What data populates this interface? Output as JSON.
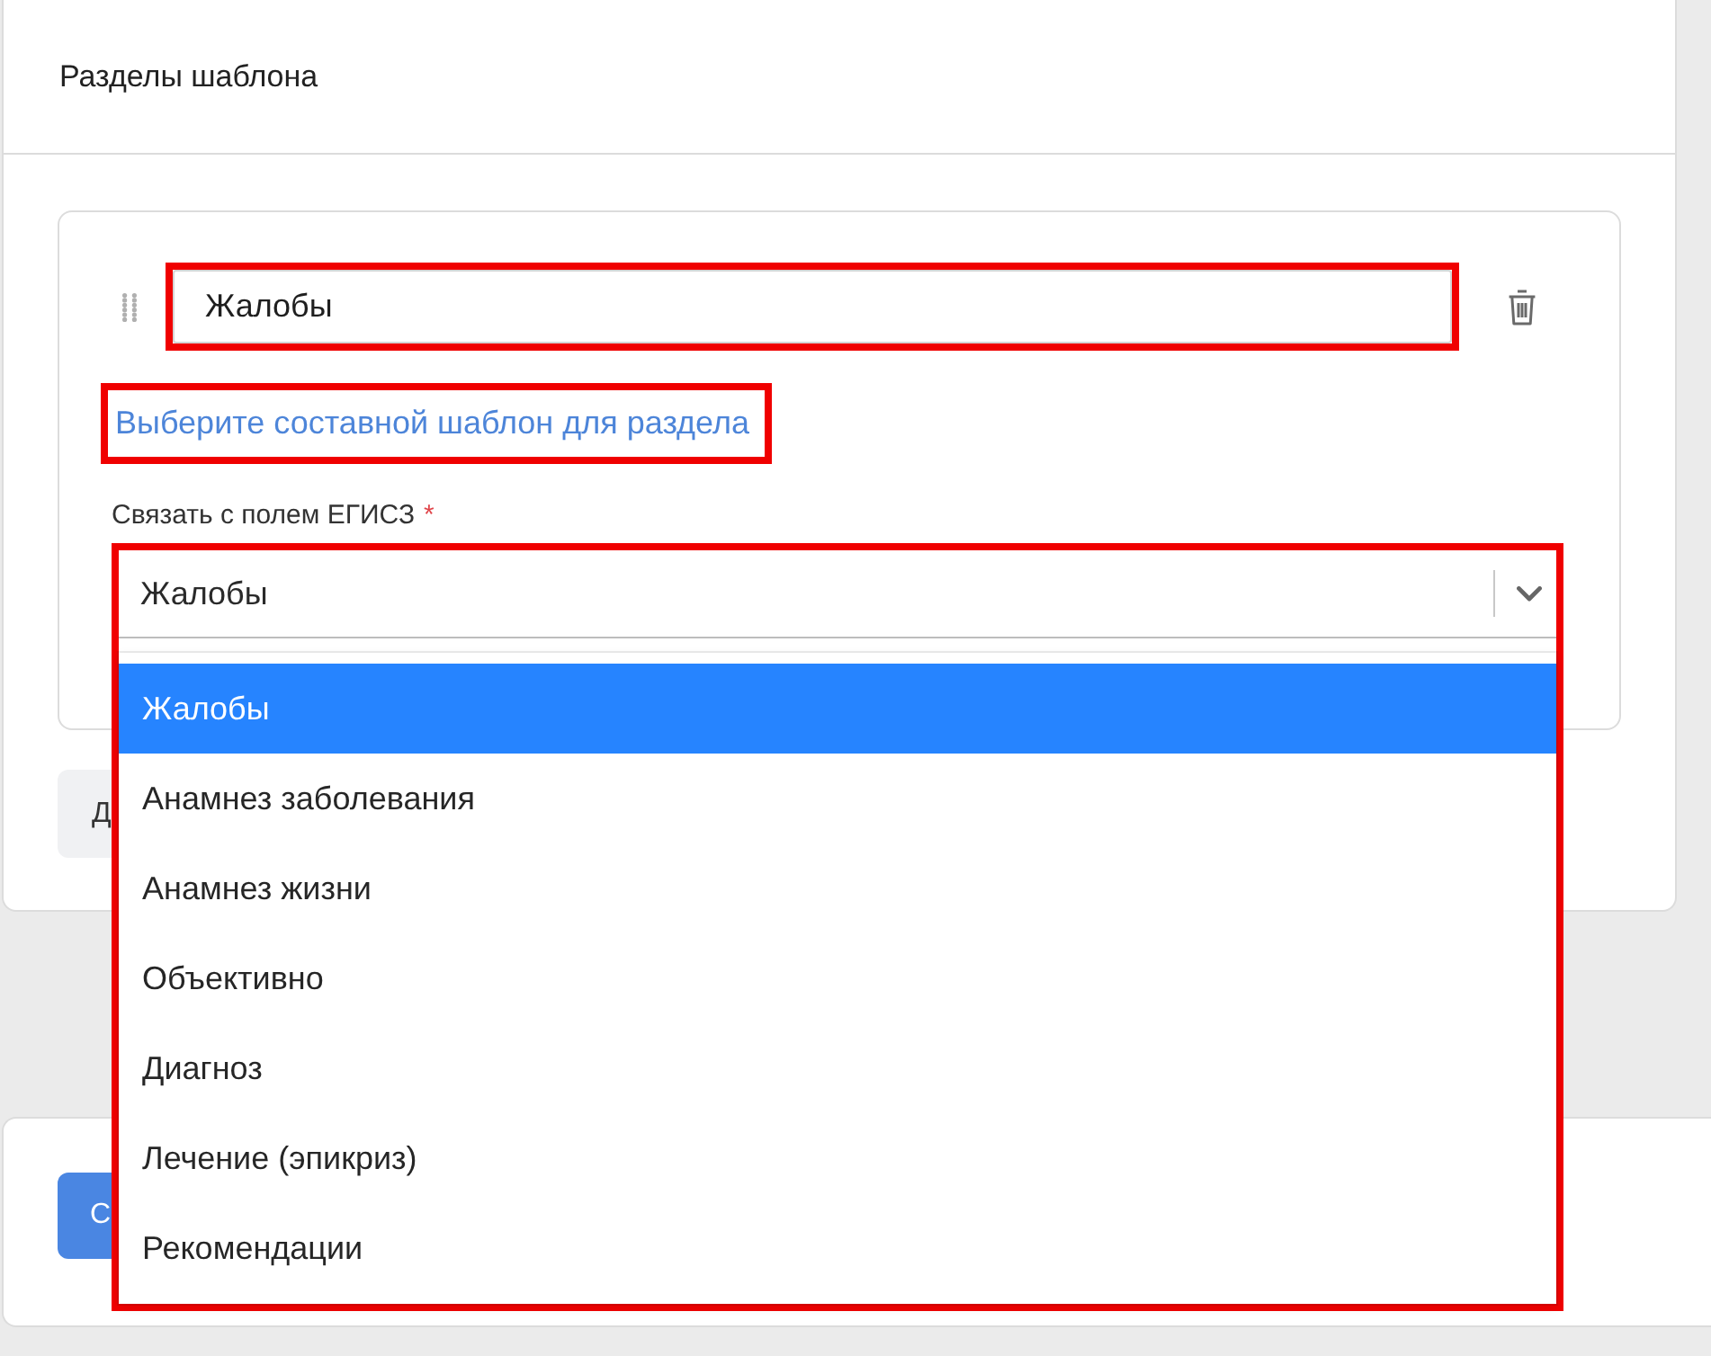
{
  "panel": {
    "title": "Разделы шаблона"
  },
  "sections": [
    {
      "name_field": {
        "value": "Жалобы",
        "highlighted": true
      },
      "template_link": {
        "label": "Выберите составной шаблон для раздела",
        "highlighted": true
      },
      "ehr_field": {
        "label": "Связать с полем ЕГИСЗ",
        "required_mark": "*",
        "value": "Жалобы",
        "expanded": true,
        "highlighted": true,
        "options": [
          {
            "label": "Жалобы",
            "selected": true
          },
          {
            "label": "Анамнез заболевания",
            "selected": false
          },
          {
            "label": "Анамнез жизни",
            "selected": false
          },
          {
            "label": "Объективно",
            "selected": false
          },
          {
            "label": "Диагноз",
            "selected": false
          },
          {
            "label": "Лечение (эпикриз)",
            "selected": false
          },
          {
            "label": "Рекомендации",
            "selected": false
          }
        ]
      }
    }
  ],
  "add_button": {
    "label": "Д"
  },
  "footer": {
    "primary_button": {
      "label": "С"
    }
  }
}
